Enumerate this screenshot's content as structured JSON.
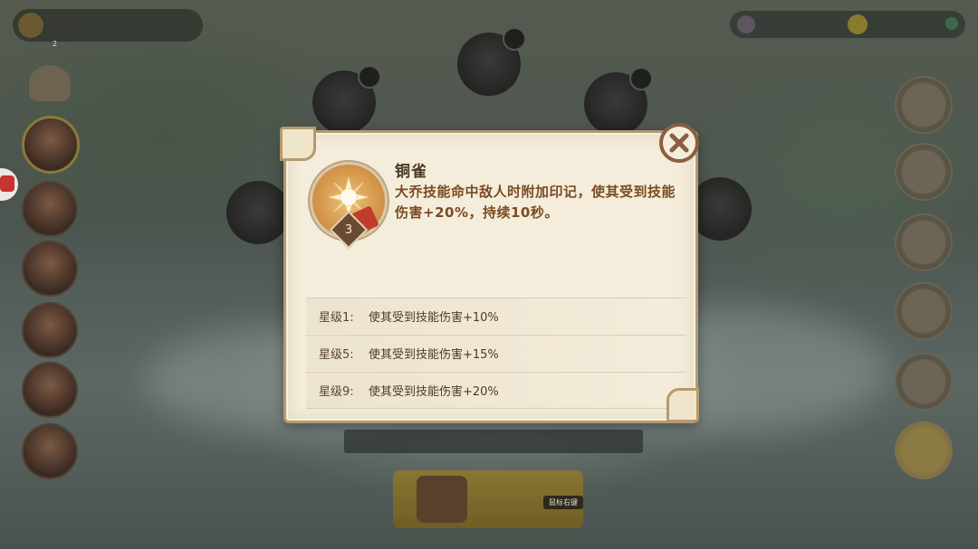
{
  "background": {
    "top_indicator": "2",
    "mouse_hint": "鼠标右键"
  },
  "popup": {
    "skill_name": "铜雀",
    "skill_star": "3",
    "skill_description": "大乔技能命中敌人时附加印记，使其受到技能伤害+20%，持续10秒。",
    "close_icon": "close-x-icon",
    "levels": [
      {
        "label": "星级1:",
        "effect": "使其受到技能伤害+10%"
      },
      {
        "label": "星级5:",
        "effect": "使其受到技能伤害+15%"
      },
      {
        "label": "星级9:",
        "effect": "使其受到技能伤害+20%"
      }
    ]
  },
  "colors": {
    "paper": "#f4eddb",
    "border": "#b49a70",
    "title_text": "#4b3826",
    "desc_text": "#7b4b22",
    "close_ring": "#8b5f3f"
  }
}
